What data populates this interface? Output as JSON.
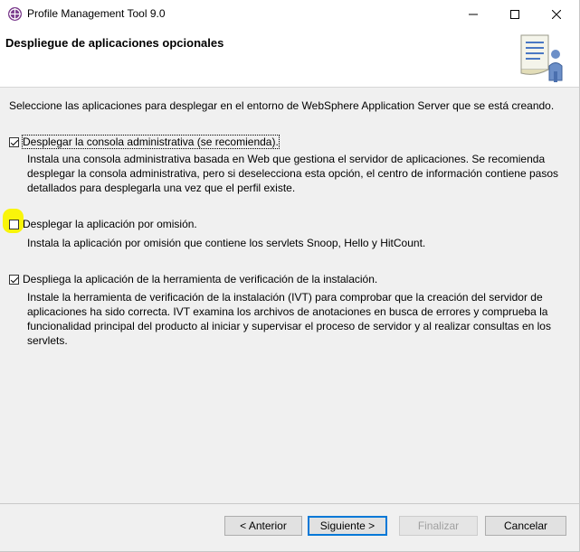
{
  "window": {
    "title": "Profile Management Tool 9.0"
  },
  "header": {
    "title": "Despliegue de aplicaciones opcionales"
  },
  "main": {
    "intro": "Seleccione las aplicaciones para desplegar en el entorno de WebSphere Application Server que se está creando.",
    "options": [
      {
        "label": "Desplegar la consola administrativa (se recomienda).",
        "checked": true,
        "description_lines": [
          "Instala una consola administrativa basada en Web que gestiona el servidor de aplicaciones. Se recomienda",
          "desplegar la consola administrativa, pero si deselecciona esta opción, el centro de información contiene pasos",
          "detallados para desplegarla una vez que el perfil existe."
        ]
      },
      {
        "label": "Desplegar la aplicación por omisión.",
        "checked": false,
        "description_lines": [
          "Instala la aplicación por omisión que contiene los servlets Snoop, Hello y HitCount."
        ]
      },
      {
        "label": "Despliega la aplicación de la herramienta de verificación de la instalación.",
        "checked": true,
        "description_lines": [
          "Instale la herramienta de verificación de la instalación (IVT) para comprobar que la creación del servidor de",
          "aplicaciones ha sido correcta. IVT examina los archivos de anotaciones en busca de errores y comprueba la",
          "funcionalidad principal del producto al iniciar y supervisar el proceso de servidor y al realizar consultas en los",
          "servlets."
        ]
      }
    ]
  },
  "footer": {
    "back": "< Anterior",
    "next": "Siguiente >",
    "finish": "Finalizar",
    "cancel": "Cancelar"
  },
  "icons": {
    "app": "websphere-globe-icon",
    "header": "profile-document-user-icon",
    "minimize": "minimize-icon",
    "maximize": "maximize-icon",
    "close": "close-icon"
  },
  "colors": {
    "highlight": "#f9f50a",
    "primary_border": "#0078d7"
  }
}
